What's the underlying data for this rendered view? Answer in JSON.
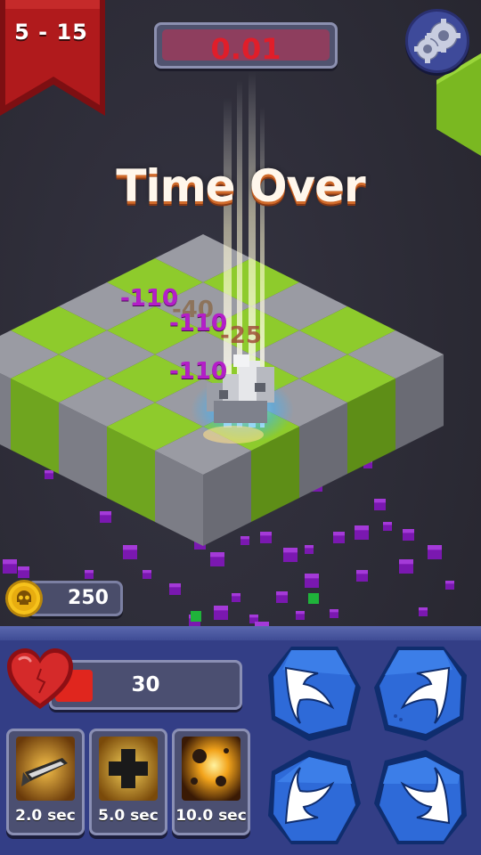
{
  "hud": {
    "level": "5 - 15",
    "timer": "0.01",
    "status_message": "Time Over"
  },
  "damage_numbers": [
    "-110",
    "-40",
    "-110",
    "-25",
    "-110"
  ],
  "coins": {
    "value": "250",
    "icon": "skull-coin-icon"
  },
  "health": {
    "value": "30",
    "fill_fraction": 0.2,
    "icon": "heart-icon"
  },
  "skills": [
    {
      "name": "blade-strike",
      "cooldown": "2.0 sec"
    },
    {
      "name": "heal-cross",
      "cooldown": "5.0 sec"
    },
    {
      "name": "explosion",
      "cooldown": "10.0 sec"
    }
  ],
  "direction_buttons": [
    "up-left",
    "up-right",
    "down-left",
    "down-right"
  ],
  "colors": {
    "tile_green": "#8ecb2c",
    "tile_grey": "#9a9ba3",
    "panel_blue": "#333e86",
    "timer_red": "#e01e2a",
    "damage_purple": "#b41ec8",
    "voxel_purple": "#7a18b0"
  }
}
